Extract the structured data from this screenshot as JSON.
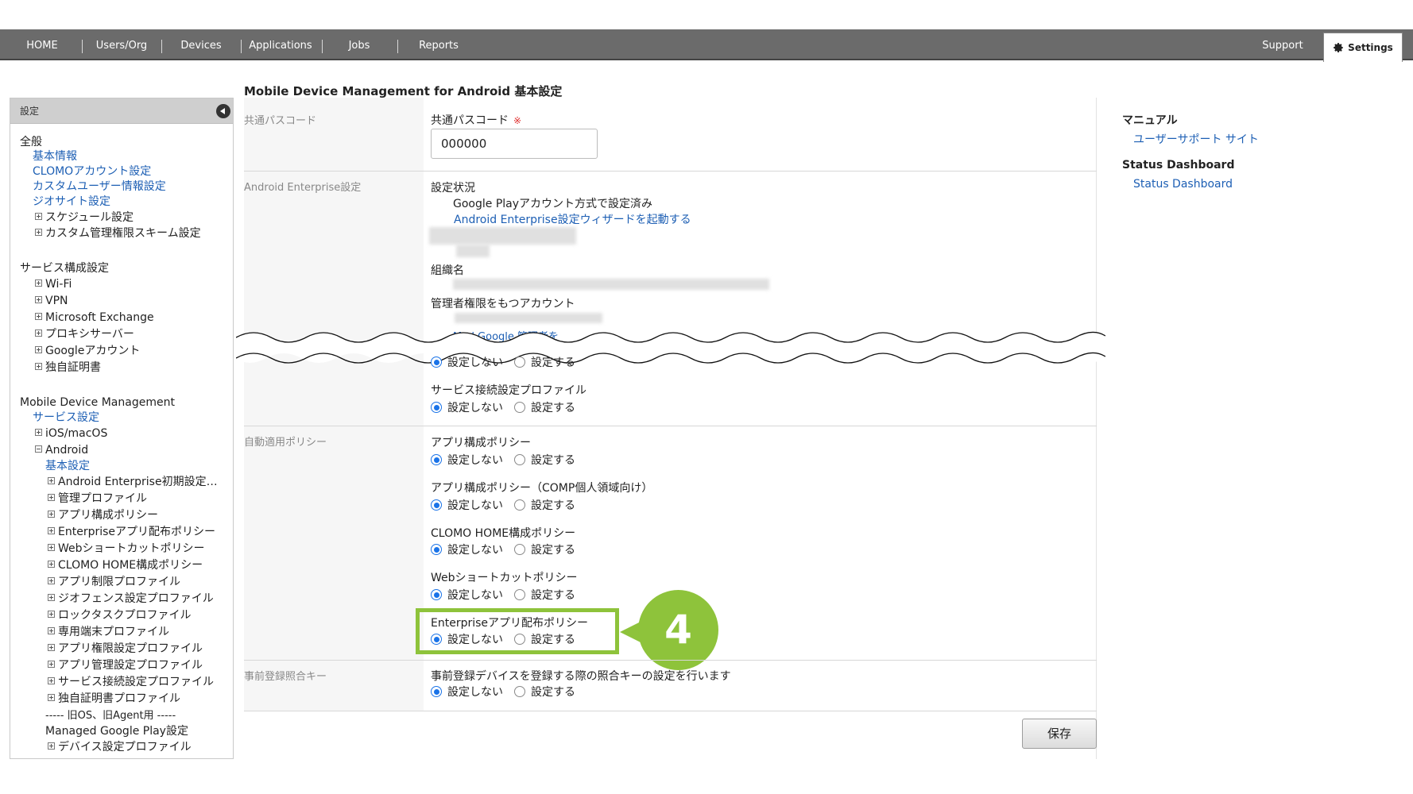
{
  "nav": {
    "items": [
      "HOME",
      "Users/Org",
      "Devices",
      "Applications",
      "Jobs",
      "Reports"
    ],
    "support": "Support",
    "settings": "Settings"
  },
  "sidebar": {
    "header": "設定",
    "general_title": "全般",
    "general_links": [
      "基本情報",
      "CLOMOアカウント設定",
      "カスタムユーザー情報設定",
      "ジオサイト設定"
    ],
    "general_expand": [
      "スケジュール設定",
      "カスタム管理権限スキーム設定"
    ],
    "service_title": "サービス構成設定",
    "service_items": [
      "Wi-Fi",
      "VPN",
      "Microsoft Exchange",
      "プロキシサーバー",
      "Googleアカウント",
      "独自証明書"
    ],
    "mdm_title": "Mobile Device Management",
    "mdm_service": "サービス設定",
    "ios": "iOS/macOS",
    "android": "Android",
    "android_basic": "基本設定",
    "android_items": [
      "Android Enterprise初期設定…",
      "管理プロファイル",
      "アプリ構成ポリシー",
      "Enterpriseアプリ配布ポリシー",
      "Webショートカットポリシー",
      "CLOMO HOME構成ポリシー",
      "アプリ制限プロファイル",
      "ジオフェンス設定プロファイル",
      "ロックタスクプロファイル",
      "専用端末プロファイル",
      "アプリ権限設定プロファイル",
      "アプリ管理設定プロファイル",
      "サービス接続設定プロファイル",
      "独自証明書プロファイル"
    ],
    "legacy_sep": "----- 旧OS、旧Agent用 -----",
    "mgp_title": "Managed Google Play設定",
    "mgp_item": "デバイス設定プロファイル"
  },
  "main": {
    "title": "Mobile Device Management for Android 基本設定",
    "passcode_section": "共通パスコード",
    "passcode_label": "共通パスコード",
    "passcode_req": "※",
    "passcode_value": "000000",
    "ae_section": "Android Enterprise設定",
    "status_label": "設定状況",
    "status_value": "Google Playアカウント方式で設定済み",
    "wizard_link": "Android Enterprise設定ウィザードを起動する",
    "org_label": "組織名",
    "admin_label": "管理者権限をもつアカウント",
    "admin_link_fragment": "Ma  l Google   管理者を",
    "opt_off": "設定しない",
    "opt_on": "設定する",
    "service_profile_label": "サービス接続設定プロファイル",
    "auto_section": "自動適用ポリシー",
    "app_config": "アプリ構成ポリシー",
    "app_config_comp": "アプリ構成ポリシー（COMP個人領域向け）",
    "home_config": "CLOMO HOME構成ポリシー",
    "web_shortcut": "Webショートカットポリシー",
    "ent_dist": "Enterpriseアプリ配布ポリシー",
    "prereg_section": "事前登録照合キー",
    "prereg_label": "事前登録デバイスを登録する際の照合キーの設定を行います",
    "save": "保存",
    "callout": "4"
  },
  "right": {
    "manual_title": "マニュアル",
    "manual_link": "ユーザーサポート サイト",
    "status_title": "Status Dashboard",
    "status_link": "Status Dashboard"
  },
  "colors": {
    "nav_bg": "#6b6b6b",
    "link": "#1d5fb4",
    "highlight": "#8ec33b",
    "radio": "#1a73e8"
  }
}
